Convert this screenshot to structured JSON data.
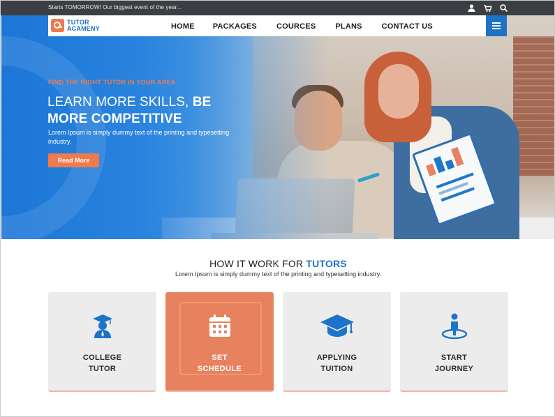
{
  "topbar": {
    "announcement": "Starts TOMORROW! Our biggest event of the year...",
    "icons": [
      "user-icon",
      "cart-icon",
      "search-icon"
    ]
  },
  "nav": {
    "logo_line1": "TUTOR",
    "logo_line2": "ACAMENY",
    "items": [
      {
        "label": "HOME"
      },
      {
        "label": "PACKAGES"
      },
      {
        "label": "COURCES"
      },
      {
        "label": "PLANS"
      },
      {
        "label": "CONTACT US"
      }
    ],
    "menu_icon": "hamburger-icon"
  },
  "hero": {
    "kicker": "FIND THE RIGHT TUTOR IN YOUR AREA",
    "headline_regular": "LEARN MORE SKILLS,",
    "headline_bold": "BE MORE COMPETITIVE",
    "subtext": "Lorem Ipsum is simply dummy text of the printing and typesetting industry.",
    "button": "Read More"
  },
  "how": {
    "title_plain": "HOW IT WORK FOR",
    "title_highlight": "TUTORS",
    "subtitle": "Lorem Ipsum is simply dummy text of the printing and typesetting industry.",
    "cards": [
      {
        "line1": "COLLEGE",
        "line2": "TUTOR",
        "icon": "graduate-icon"
      },
      {
        "line1": "SET",
        "line2": "SCHEDULE",
        "icon": "calendar-icon"
      },
      {
        "line1": "APPLYING",
        "line2": "TUITION",
        "icon": "mortarboard-icon"
      },
      {
        "line1": "START",
        "line2": "JOURNEY",
        "icon": "location-person-icon"
      }
    ]
  },
  "colors": {
    "primary_blue": "#1c73c9",
    "accent_orange": "#ef7a4e",
    "topbar": "#3b3f44",
    "card_bg": "#ececec"
  }
}
